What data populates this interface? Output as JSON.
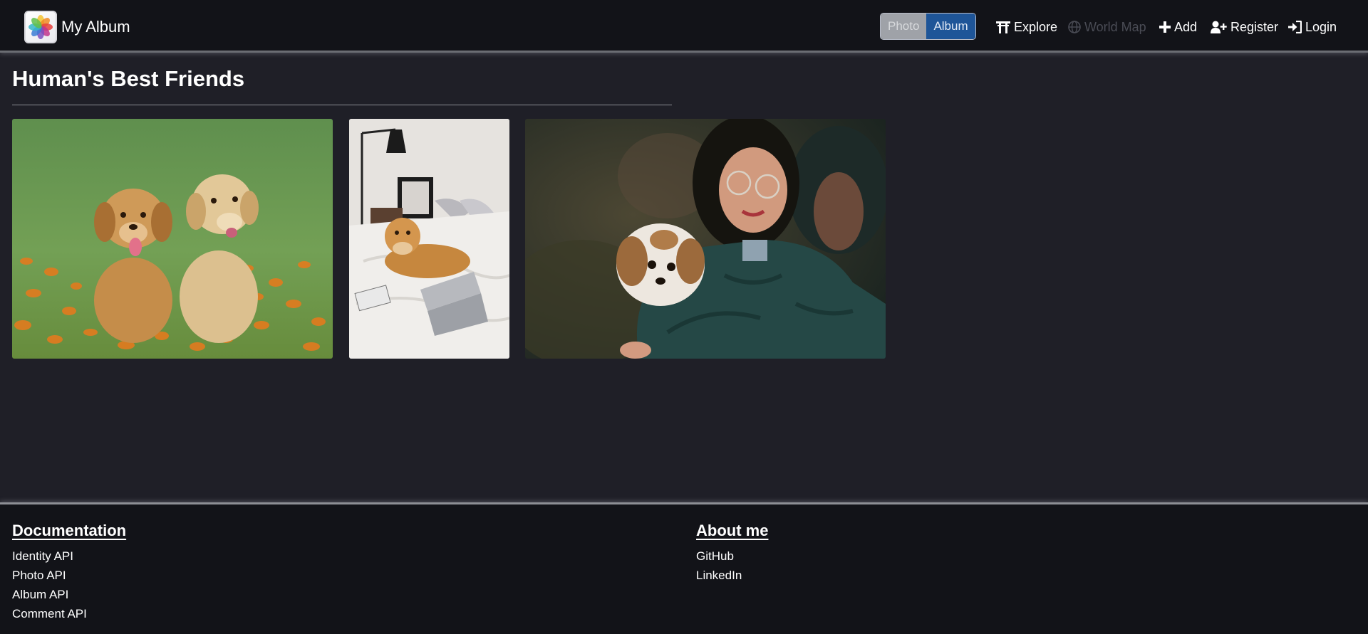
{
  "nav": {
    "brand": "My Album",
    "toggle": {
      "photo": "Photo",
      "album": "Album"
    },
    "items": [
      {
        "label": "Explore",
        "icon": "torii-gate-icon"
      },
      {
        "label": "World Map",
        "icon": "globe-icon",
        "disabled": true
      },
      {
        "label": "Add",
        "icon": "plus-icon"
      },
      {
        "label": "Register",
        "icon": "user-plus-icon"
      },
      {
        "label": "Login",
        "icon": "sign-in-icon"
      }
    ]
  },
  "album": {
    "title": "Human's Best Friends",
    "photos": [
      {
        "name": "photo-puppies-in-flowers"
      },
      {
        "name": "photo-dog-on-bed"
      },
      {
        "name": "photo-couple-with-dog"
      }
    ]
  },
  "footer": {
    "documentation": {
      "heading": "Documentation",
      "links": [
        "Identity API",
        "Photo API",
        "Album API",
        "Comment API"
      ]
    },
    "about": {
      "heading": "About me",
      "links": [
        "GitHub",
        "LinkedIn"
      ]
    }
  },
  "colors": {
    "background": "#1f1f27",
    "navbar": "#121318",
    "toggle_active": "#1e5598",
    "toggle_inactive": "#9fa2a8",
    "disabled_text": "#4a4c55"
  }
}
